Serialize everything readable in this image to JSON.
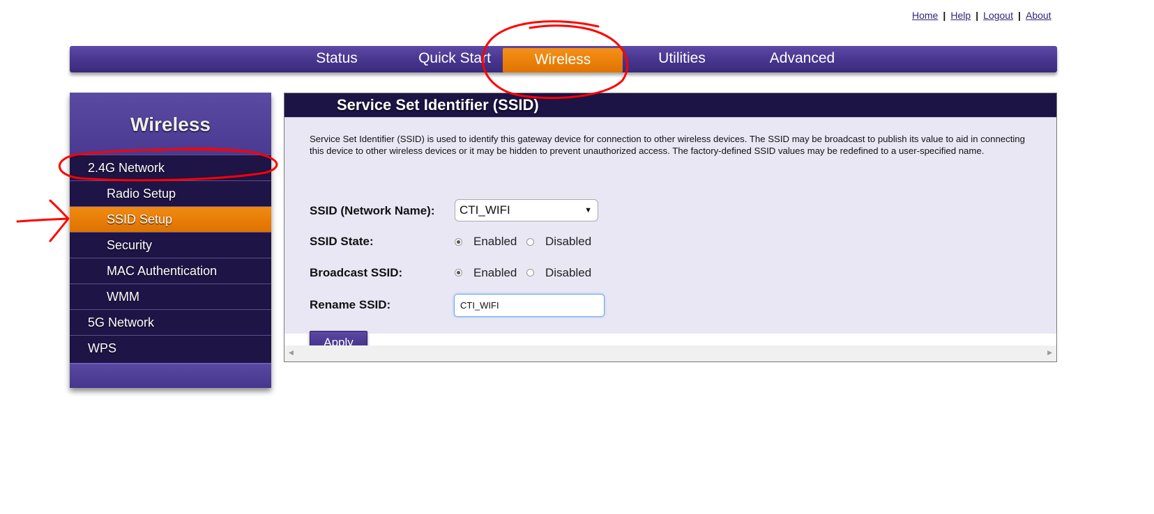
{
  "top_links": [
    "Home",
    "Help",
    "Logout",
    "About"
  ],
  "nav": {
    "tabs": [
      "Status",
      "Quick Start",
      "Wireless",
      "Utilities",
      "Advanced"
    ],
    "active": "Wireless"
  },
  "sidebar": {
    "title": "Wireless",
    "items": [
      {
        "label": "2.4G Network"
      },
      {
        "label": "Radio Setup"
      },
      {
        "label": "SSID Setup",
        "active": true
      },
      {
        "label": "Security"
      },
      {
        "label": "MAC Authentication"
      },
      {
        "label": "WMM"
      },
      {
        "label": "5G Network"
      },
      {
        "label": "WPS"
      }
    ]
  },
  "panel": {
    "title": "Service Set Identifier (SSID)",
    "description": "Service Set Identifier (SSID) is used to identify this gateway device for connection to other wireless devices. The SSID may be broadcast to publish its value to aid in connecting this device to other wireless devices or it may be hidden to prevent unauthorized access. The factory-defined SSID values may be redefined to a user-specified name.",
    "ssid_label": "SSID (Network Name):",
    "ssid_value": "CTI_WIFI",
    "ssid_state_label": "SSID State:",
    "ssid_state": "Enabled",
    "broadcast_label": "Broadcast SSID:",
    "broadcast": "Enabled",
    "option_enabled": "Enabled",
    "option_disabled": "Disabled",
    "rename_label": "Rename SSID:",
    "rename_value": "CTI_WIFI",
    "apply_label": "Apply"
  },
  "colors": {
    "nav_purple": "#4a3892",
    "active_orange": "#e97f0a",
    "dark_navy": "#1e1445",
    "annotation_red": "#ff0000"
  }
}
